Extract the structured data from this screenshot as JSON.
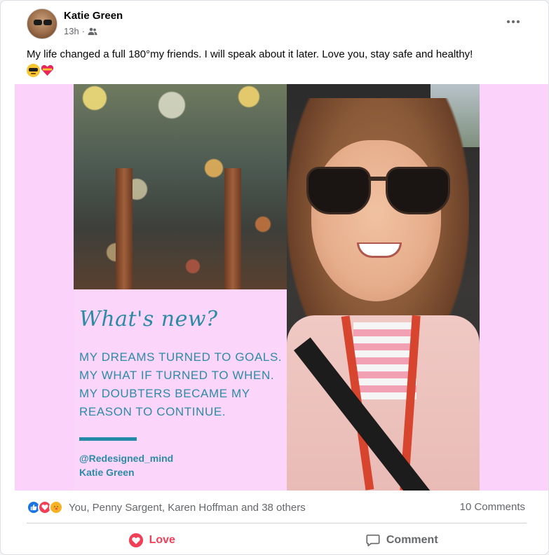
{
  "post": {
    "author": "Katie Green",
    "time": "13h",
    "audience_icon": "friends-icon",
    "text": "My life changed a full 180°my friends. I will speak about it later. Love you, stay safe and healthy!",
    "emojis": [
      "smiling-face-with-sunglasses",
      "heart-with-ribbon"
    ]
  },
  "media": {
    "quote_title": "What's new?",
    "quote_lines": [
      "MY DREAMS TURNED TO GOALS.",
      "MY WHAT IF TURNED TO WHEN.",
      "MY DOUBTERS BECAME MY",
      "REASON TO CONTINUE."
    ],
    "handle": "@Redesigned_mind",
    "name": "Katie Green",
    "background": "#fbd2f9",
    "accent": "#2c8ba7"
  },
  "reactions": {
    "icons": [
      "like-icon",
      "love-icon",
      "care-icon"
    ],
    "summary": "You, Penny Sargent, Karen Hoffman and 38 others",
    "comments": "10 Comments"
  },
  "actions": {
    "love": "Love",
    "comment": "Comment"
  },
  "colors": {
    "love": "#f33e58",
    "like": "#1b74e4",
    "secondary_text": "#65676b"
  }
}
